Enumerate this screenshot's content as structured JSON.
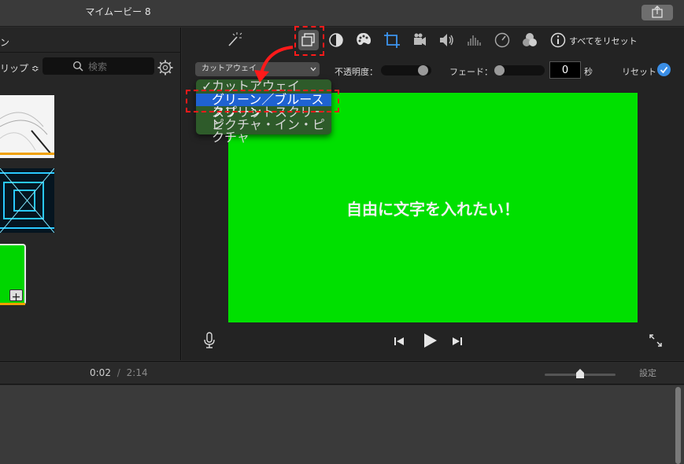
{
  "window": {
    "title": "マイムービー 8",
    "share_icon": "share-icon"
  },
  "library": {
    "header_label": "ン",
    "clip_filter_label": "リップ ≎",
    "search_placeholder": "検索"
  },
  "viewer_toolbar": {
    "tools": [
      "magic-wand-icon",
      "overlay-settings-icon",
      "color-balance-icon",
      "color-correction-icon",
      "crop-icon",
      "stabilization-icon",
      "volume-icon",
      "noise-reduction-icon",
      "speed-icon",
      "clip-filter-icon",
      "info-icon"
    ],
    "reset_all_label": "すべてをリセット"
  },
  "overlay": {
    "dropdown_value": "カットアウェイ",
    "opacity_label": "不透明度：",
    "opacity_value": 0.92,
    "fade_label": "フェード：",
    "fade_value": 0.0,
    "seconds_value": "0",
    "seconds_unit": "秒",
    "reset_label": "リセット"
  },
  "overlay_menu": {
    "options": [
      "カットアウェイ",
      "グリーン／ブルースクリーン",
      "スプリットスクリーン",
      "ピクチャ・イン・ピクチャ"
    ],
    "checked_index": 0,
    "highlighted_index": 1
  },
  "preview": {
    "text": "自由に文字を入れたい！",
    "background": "#00e000"
  },
  "playback": {
    "controls": [
      "microphone-icon",
      "previous-icon",
      "play-icon",
      "next-icon",
      "fullscreen-icon"
    ]
  },
  "timeline": {
    "current_time": "0:02",
    "separator": "/",
    "total_time": "2:14",
    "settings_label": "設定"
  },
  "colors": {
    "accent": "#1f62d1",
    "annotation": "#ff1a1a",
    "menu_bg": "#2e5b2a"
  }
}
